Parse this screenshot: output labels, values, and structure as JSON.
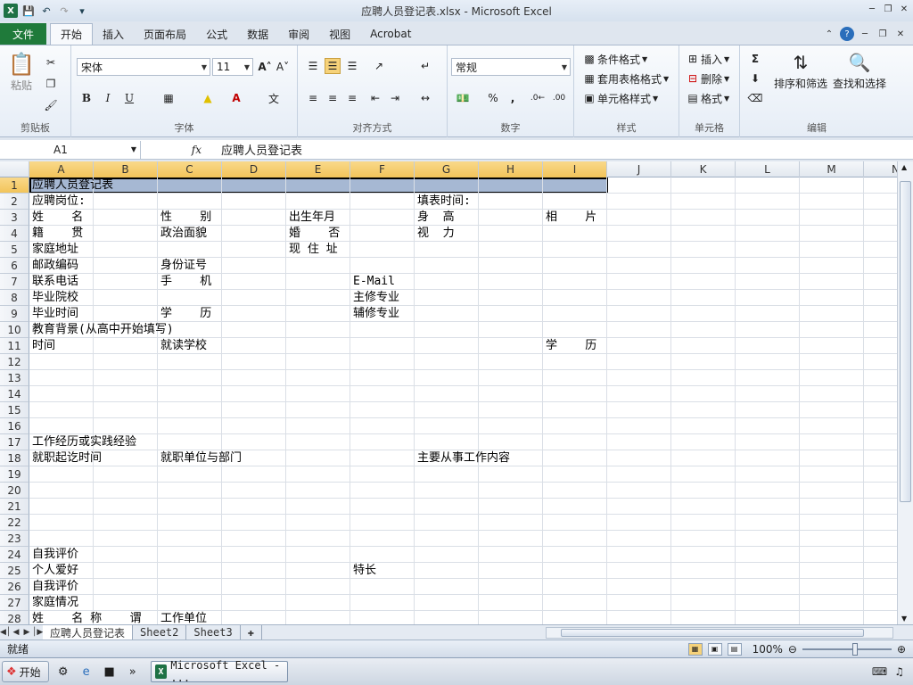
{
  "window": {
    "title": "应聘人员登记表.xlsx - Microsoft Excel",
    "qat": [
      "save-icon",
      "undo-icon",
      "redo-icon",
      "customize-icon"
    ]
  },
  "tabs": [
    {
      "label": "文件",
      "kind": "file"
    },
    {
      "label": "开始",
      "kind": "active"
    },
    {
      "label": "插入"
    },
    {
      "label": "页面布局"
    },
    {
      "label": "公式"
    },
    {
      "label": "数据"
    },
    {
      "label": "审阅"
    },
    {
      "label": "视图"
    },
    {
      "label": "Acrobat"
    }
  ],
  "ribbon": {
    "clipboard": {
      "label": "剪贴板",
      "paste": "粘贴"
    },
    "font": {
      "label": "字体",
      "name": "宋体",
      "size": "11",
      "bold": "B",
      "italic": "I",
      "underline": "U"
    },
    "alignment": {
      "label": "对齐方式"
    },
    "number": {
      "label": "数字",
      "format": "常规",
      "percent": "%",
      "comma": ","
    },
    "styles": {
      "label": "样式",
      "conditional": "条件格式",
      "table": "套用表格格式",
      "cell": "单元格样式"
    },
    "cells": {
      "label": "单元格",
      "insert": "插入",
      "delete": "删除",
      "format": "格式"
    },
    "editing": {
      "label": "编辑",
      "sum": "Σ",
      "sort": "排序和筛选",
      "find": "查找和选择"
    }
  },
  "formula_bar": {
    "name_box": "A1",
    "fx": "fx",
    "content": "应聘人员登记表"
  },
  "columns": [
    "A",
    "B",
    "C",
    "D",
    "E",
    "F",
    "G",
    "H",
    "I",
    "J",
    "K",
    "L",
    "M",
    "N"
  ],
  "rows": [
    "1",
    "2",
    "3",
    "4",
    "5",
    "6",
    "7",
    "8",
    "9",
    "10",
    "11",
    "12",
    "13",
    "14",
    "15",
    "16",
    "17",
    "18",
    "19",
    "20",
    "21",
    "22",
    "23",
    "24",
    "25",
    "26",
    "27",
    "28"
  ],
  "selected": {
    "column": "A",
    "row": "1"
  },
  "cells": [
    {
      "row": 1,
      "col": 0,
      "text": "应聘人员登记表"
    },
    {
      "row": 2,
      "col": 0,
      "text": "应聘岗位:"
    },
    {
      "row": 2,
      "col": 6,
      "text": "填表时间:"
    },
    {
      "row": 3,
      "col": 0,
      "text": "姓    名"
    },
    {
      "row": 3,
      "col": 2,
      "text": "性    别"
    },
    {
      "row": 3,
      "col": 4,
      "text": "出生年月"
    },
    {
      "row": 3,
      "col": 6,
      "text": "身  高"
    },
    {
      "row": 3,
      "col": 8,
      "text": "相    片"
    },
    {
      "row": 4,
      "col": 0,
      "text": "籍    贯"
    },
    {
      "row": 4,
      "col": 2,
      "text": "政治面貌"
    },
    {
      "row": 4,
      "col": 4,
      "text": "婚    否"
    },
    {
      "row": 4,
      "col": 6,
      "text": "视  力"
    },
    {
      "row": 5,
      "col": 0,
      "text": "家庭地址"
    },
    {
      "row": 5,
      "col": 4,
      "text": "现 住 址"
    },
    {
      "row": 6,
      "col": 0,
      "text": "邮政编码"
    },
    {
      "row": 6,
      "col": 2,
      "text": "身份证号"
    },
    {
      "row": 7,
      "col": 0,
      "text": "联系电话"
    },
    {
      "row": 7,
      "col": 2,
      "text": "手    机"
    },
    {
      "row": 7,
      "col": 5,
      "text": "E-Mail"
    },
    {
      "row": 8,
      "col": 0,
      "text": "毕业院校"
    },
    {
      "row": 8,
      "col": 5,
      "text": "主修专业"
    },
    {
      "row": 9,
      "col": 0,
      "text": "毕业时间"
    },
    {
      "row": 9,
      "col": 2,
      "text": "学    历"
    },
    {
      "row": 9,
      "col": 5,
      "text": "辅修专业"
    },
    {
      "row": 10,
      "col": 0,
      "text": "教育背景(从高中开始填写)"
    },
    {
      "row": 11,
      "col": 0,
      "text": "时间"
    },
    {
      "row": 11,
      "col": 2,
      "text": "就读学校"
    },
    {
      "row": 11,
      "col": 8,
      "text": "学    历"
    },
    {
      "row": 17,
      "col": 0,
      "text": "工作经历或实践经验"
    },
    {
      "row": 18,
      "col": 0,
      "text": "就职起讫时间"
    },
    {
      "row": 18,
      "col": 2,
      "text": "就职单位与部门"
    },
    {
      "row": 18,
      "col": 6,
      "text": "主要从事工作内容"
    },
    {
      "row": 24,
      "col": 0,
      "text": "自我评价"
    },
    {
      "row": 25,
      "col": 0,
      "text": "个人爱好"
    },
    {
      "row": 25,
      "col": 5,
      "text": "特长"
    },
    {
      "row": 26,
      "col": 0,
      "text": "自我评价"
    },
    {
      "row": 27,
      "col": 0,
      "text": "家庭情况"
    },
    {
      "row": 28,
      "col": 0,
      "text": "姓    名 称    谓"
    },
    {
      "row": 28,
      "col": 2,
      "text": "工作单位"
    }
  ],
  "sheets": [
    {
      "label": "应聘人员登记表",
      "active": true
    },
    {
      "label": "Sheet2"
    },
    {
      "label": "Sheet3"
    }
  ],
  "status": {
    "text": "就绪",
    "zoom": "100%"
  },
  "taskbar": {
    "start": "开始",
    "item": "Microsoft Excel - ..."
  },
  "colors": {
    "file_tab": "#1f7a3a",
    "selection_fill": "#a6b8d3",
    "header_highlight": "#f2c45a"
  }
}
